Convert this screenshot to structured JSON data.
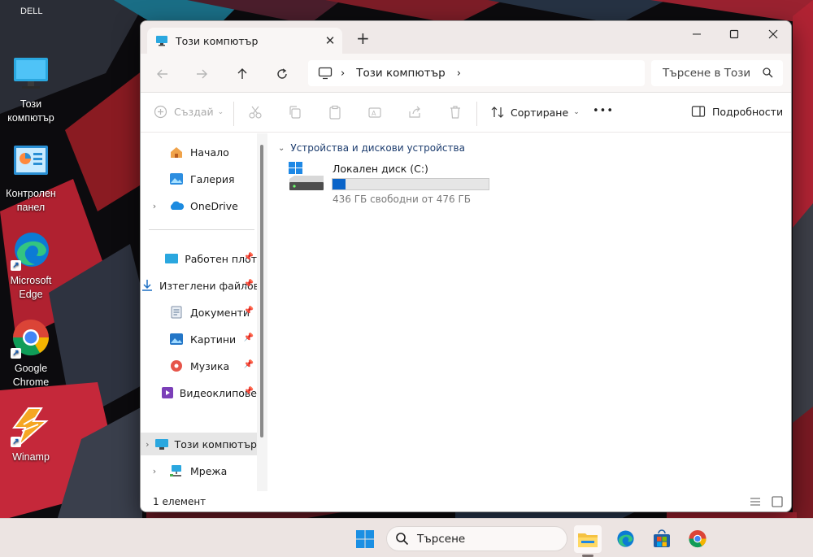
{
  "desktop": {
    "oem_label": "DELL",
    "icons": [
      {
        "line1": "Този",
        "line2": "компютър",
        "icon": "computer-icon"
      },
      {
        "line1": "Контролен",
        "line2": "панел",
        "icon": "control-panel-icon"
      },
      {
        "line1": "Microsoft",
        "line2": "Edge",
        "icon": "edge-icon"
      },
      {
        "line1": "Google",
        "line2": "Chrome",
        "icon": "chrome-icon"
      },
      {
        "line1": "Winamp",
        "line2": "",
        "icon": "winamp-icon"
      }
    ]
  },
  "window": {
    "tab_title": "Този компютър",
    "address": {
      "location": "Този компютър"
    },
    "search_placeholder": "Търсене в Този",
    "toolbar": {
      "create_label": "Създай",
      "sort_label": "Сортиране",
      "more_label": "•••",
      "details_label": "Подробности"
    },
    "nav": {
      "items": [
        {
          "label": "Начало",
          "icon": "home-icon"
        },
        {
          "label": "Галерия",
          "icon": "gallery-icon"
        },
        {
          "label": "OneDrive",
          "icon": "onedrive-icon"
        },
        {
          "label": "Работен плот",
          "icon": "desktop-folder-icon"
        },
        {
          "label": "Изтеглени файлове",
          "icon": "downloads-icon"
        },
        {
          "label": "Документи",
          "icon": "documents-icon"
        },
        {
          "label": "Картини",
          "icon": "pictures-icon"
        },
        {
          "label": "Музика",
          "icon": "music-icon"
        },
        {
          "label": "Видеоклипове",
          "icon": "videos-icon"
        },
        {
          "label": "Този компютър",
          "icon": "computer-icon"
        },
        {
          "label": "Мрежа",
          "icon": "network-icon"
        }
      ]
    },
    "content": {
      "group_header": "Устройства и дискови устройства",
      "drive": {
        "name": "Локален диск (C:)",
        "free_text": "436 ГБ свободни от 476 ГБ",
        "used_fraction": 0.084
      }
    },
    "status": {
      "item_count": "1 елемент"
    }
  },
  "taskbar": {
    "search_label": "Търсене",
    "apps": [
      "start-icon",
      "file-explorer-icon",
      "edge-icon",
      "store-icon",
      "chrome-icon"
    ]
  },
  "colors": {
    "accent": "#0a64c9",
    "taskbar": "#ece4e2",
    "titlebar": "#efe9e8"
  }
}
